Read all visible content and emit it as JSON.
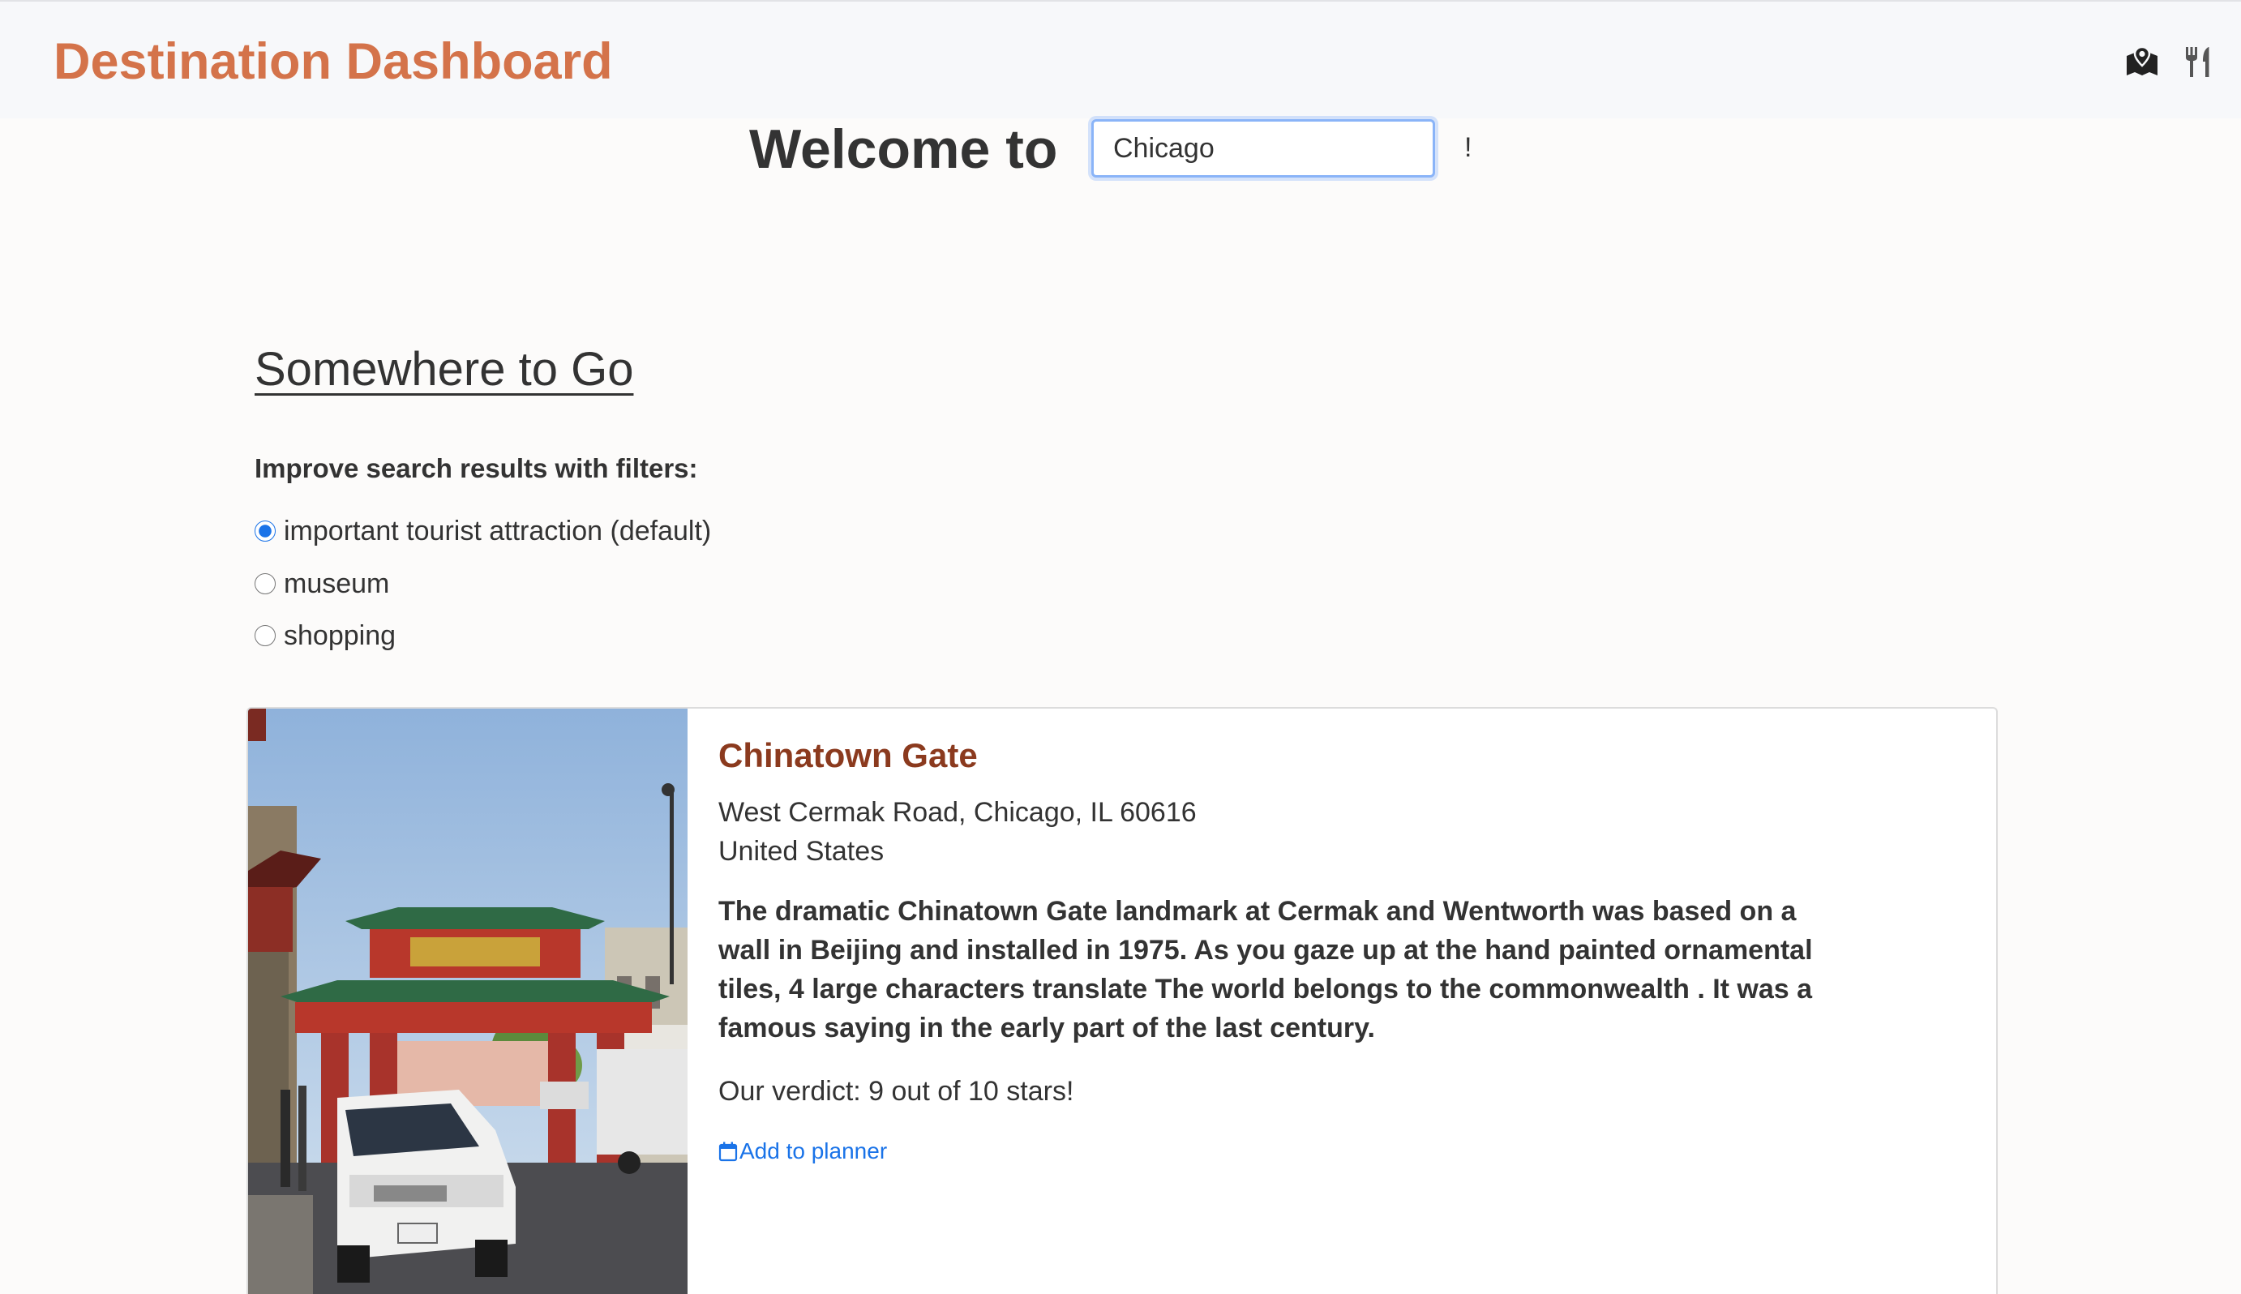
{
  "header": {
    "brand": "Destination Dashboard",
    "icons": [
      "map-icon",
      "utensils-icon"
    ]
  },
  "welcome": {
    "prefix": "Welcome to",
    "city_value": "Chicago",
    "suffix": "!"
  },
  "section": {
    "title": "Somewhere to Go",
    "filters_label": "Improve search results with filters:",
    "filters": [
      {
        "label": "important tourist attraction (default)",
        "checked": true
      },
      {
        "label": "museum",
        "checked": false
      },
      {
        "label": "shopping",
        "checked": false
      }
    ]
  },
  "card": {
    "title": "Chinatown Gate",
    "address_line1": "West Cermak Road, Chicago, IL 60616",
    "address_line2": "United States",
    "description": "The dramatic Chinatown Gate landmark at Cermak and Wentworth was based on a wall in Beijing and installed in 1975. As you gaze up at the hand painted ornamental tiles, 4 large characters translate The world belongs to the commonwealth . It was a famous saying in the early part of the last century.",
    "verdict": "Our verdict: 9 out of 10 stars!",
    "planner_link": "Add to planner",
    "planner_icon": "calendar-icon"
  },
  "colors": {
    "brand": "#d4734a",
    "card_title": "#8b3a1e",
    "link": "#1a73e8",
    "header_bg": "#f7f8fa"
  }
}
